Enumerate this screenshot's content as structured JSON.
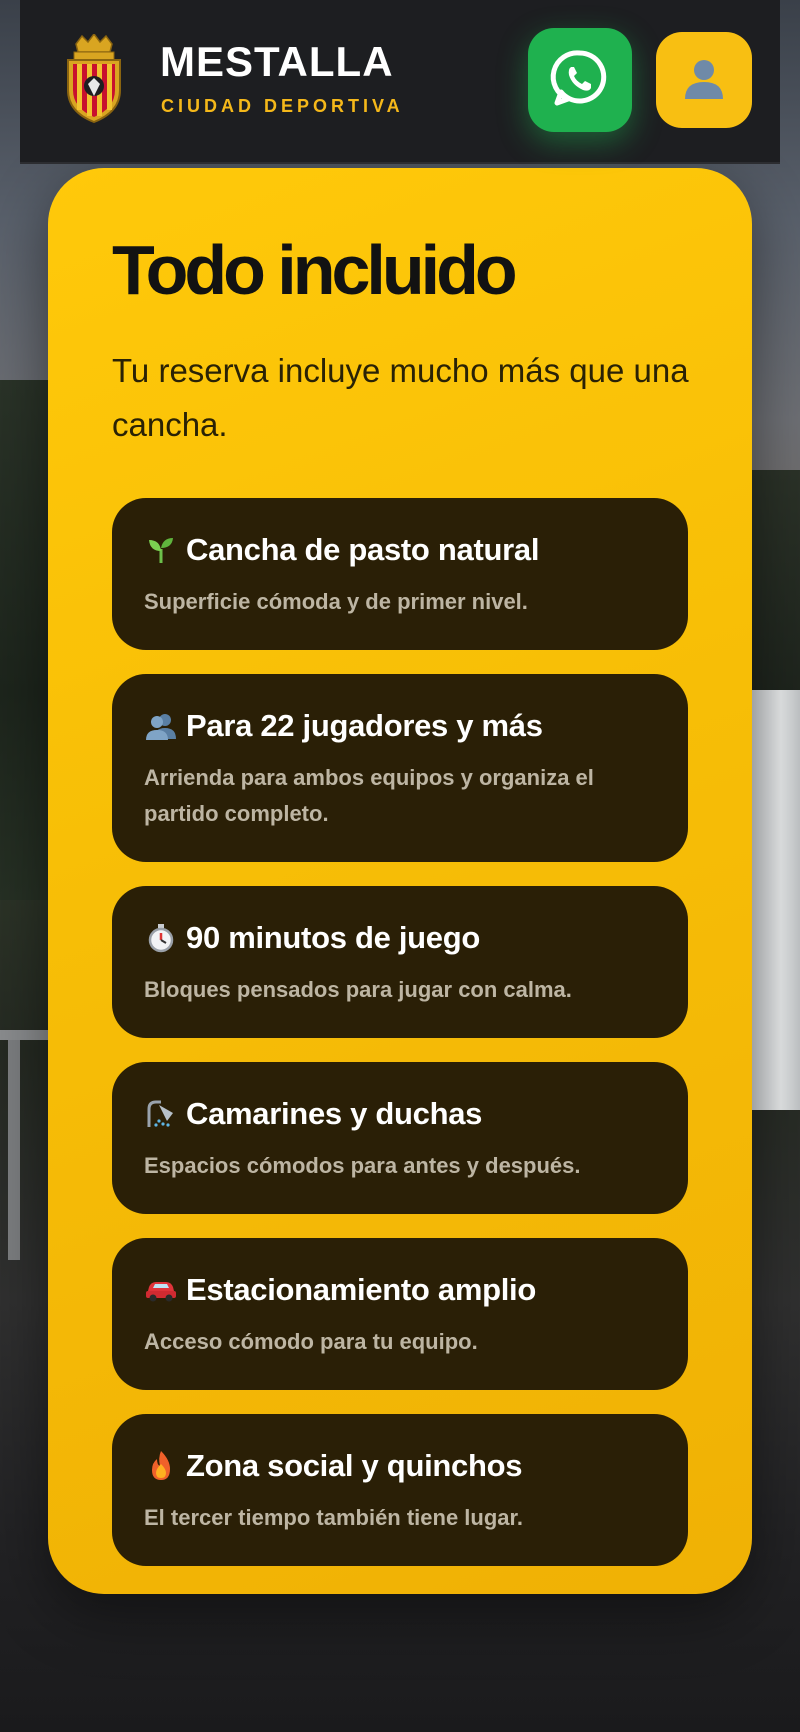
{
  "header": {
    "brand_title": "MESTALLA",
    "brand_subtitle": "CIUDAD DEPORTIVA",
    "crest_icon": "club-crest-icon",
    "whatsapp_icon": "whatsapp-icon",
    "user_icon": "user-icon"
  },
  "card": {
    "title": "Todo incluido",
    "intro": "Tu reserva incluye mucho más que una cancha.",
    "features": [
      {
        "icon": "seedling-icon",
        "title": "Cancha de pasto natural",
        "desc": "Superficie cómoda y de primer nivel."
      },
      {
        "icon": "people-icon",
        "title": "Para 22 jugadores y más",
        "desc": "Arrienda para ambos equipos y organiza el partido completo."
      },
      {
        "icon": "stopwatch-icon",
        "title": "90 minutos de juego",
        "desc": "Bloques pensados para jugar con calma."
      },
      {
        "icon": "shower-icon",
        "title": "Camarines y duchas",
        "desc": "Espacios cómodos para antes y después."
      },
      {
        "icon": "car-icon",
        "title": "Estacionamiento amplio",
        "desc": "Acceso cómodo para tu equipo."
      },
      {
        "icon": "fire-icon",
        "title": "Zona social y quinchos",
        "desc": "El tercer tiempo también tiene lugar."
      }
    ]
  },
  "colors": {
    "accent_yellow": "#f8bf12",
    "whatsapp_green": "#1fb14f",
    "header_bg": "#1d1e21",
    "feature_bg": "#2a1f06"
  }
}
